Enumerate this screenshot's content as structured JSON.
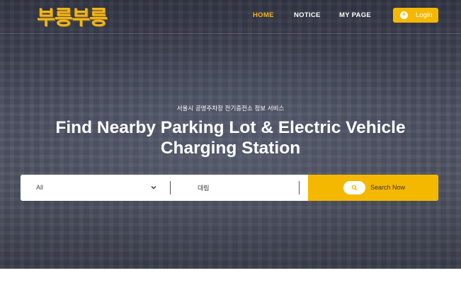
{
  "header": {
    "logo_text": "부릉부릉",
    "nav": [
      {
        "label": "HOME",
        "active": true
      },
      {
        "label": "NOTICE",
        "active": false
      },
      {
        "label": "MY PAGE",
        "active": false
      }
    ],
    "login_label": "Login",
    "login_icon": "plus-circle-icon"
  },
  "hero": {
    "subtitle": "서울시 공영주차장 전기충전소 정보 서비스",
    "headline_line1": "Find Nearby Parking Lot & Electric Vehicle",
    "headline_line2": "Charging Station"
  },
  "search": {
    "category_value": "All",
    "keyword_value": "대림",
    "button_label": "Search Now",
    "button_icon": "search-icon"
  },
  "colors": {
    "accent": "#f5b800",
    "nav_active": "#f3b61f",
    "logo": "#f1b51c"
  }
}
